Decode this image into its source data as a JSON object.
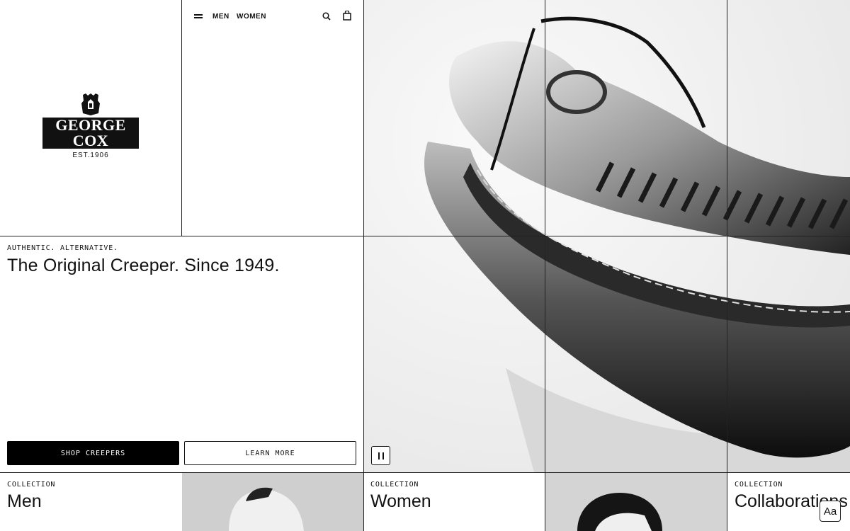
{
  "brand": {
    "name": "GEORGE COX",
    "established": "EST.1906",
    "crest_icon": "crest-icon"
  },
  "nav": {
    "menu_icon": "hamburger-icon",
    "links": [
      "MEN",
      "WOMEN"
    ],
    "search_icon": "search-icon",
    "bag_icon": "shopping-bag-icon"
  },
  "hero": {
    "eyebrow": "AUTHENTIC. ALTERNATIVE.",
    "headline": "The Original Creeper. Since 1949.",
    "primary_cta": "SHOP CREEPERS",
    "secondary_cta": "LEARN MORE",
    "pause_icon": "pause-icon"
  },
  "collections": [
    {
      "label": "COLLECTION",
      "title": "Men"
    },
    {
      "label": "COLLECTION",
      "title": "Women"
    },
    {
      "label": "COLLECTION",
      "title": "Collaborations"
    }
  ],
  "font_toggle": "Aa",
  "colors": {
    "ink": "#111111",
    "background": "#ffffff",
    "grid": "#222222"
  }
}
